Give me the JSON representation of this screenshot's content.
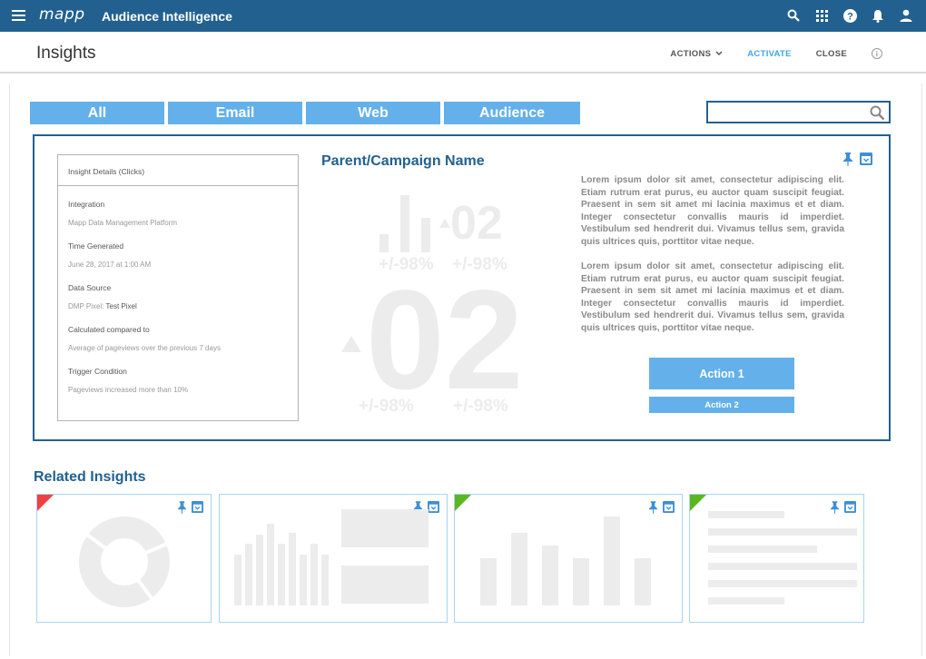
{
  "app": {
    "logo": "mapp",
    "title": "Audience Intelligence"
  },
  "topbar_icons": [
    "menu-icon",
    "search-icon",
    "apps-grid-icon",
    "help-icon",
    "notifications-bell-icon",
    "user-account-icon"
  ],
  "header": {
    "page_title": "Insights",
    "actions_label": "ACTIONS",
    "activate_label": "ACTIVATE",
    "close_label": "CLOSE",
    "info_glyph": "i"
  },
  "tabs": [
    "All",
    "Email",
    "Web",
    "Audience"
  ],
  "search": {
    "placeholder": ""
  },
  "insight": {
    "details_title": "Insight Details (Clicks)",
    "integration_label": "Integration",
    "integration_value": "Mapp Data Management Platform",
    "time_label": "Time Generated",
    "time_value": "June 28, 2017 at 1:00 AM",
    "source_label": "Data Source",
    "source_prefix": "DMP Pixel: ",
    "source_value": "Test Pixel",
    "calc_label": "Calculated compared to",
    "calc_value": "Average of pageviews over the previous 7 days",
    "trigger_label": "Trigger Condition",
    "trigger_value": "Pageviews increased more than 10%",
    "campaign_name": "Parent/Campaign Name",
    "bg_small_number": "02",
    "bg_small_pct_1": "+/-98%",
    "bg_small_pct_2": "+/-98%",
    "bg_big_number": "02",
    "bg_big_pct_1": "+/-98%",
    "bg_big_pct_2": "+/-98%",
    "lorem_1": "Lorem ipsum dolor sit amet, consectetur adipiscing elit. Etiam rutrum erat purus, eu auctor quam suscipit feugiat. Praesent in sem sit amet mi lacinia maximus et et diam. Integer consectetur convallis mauris id imperdiet. Vestibulum sed hendrerit dui. Vivamus tellus sem, gravida quis ultrices quis, porttitor vitae neque.",
    "lorem_2": "Lorem ipsum dolor sit amet, consectetur adipiscing elit. Etiam rutrum erat purus, eu auctor quam suscipit feugiat. Praesent in sem sit amet mi lacinia maximus et et diam. Integer consectetur convallis mauris id imperdiet. Vestibulum sed hendrerit dui. Vivamus tellus sem, gravida quis ultrices quis, porttitor vitae neque.",
    "action1_label": "Action 1",
    "action2_label": "Action 2"
  },
  "related": {
    "title": "Related Insights",
    "cards": [
      {
        "type": "donut",
        "corner_color": "#f04141"
      },
      {
        "type": "bars-and-blocks",
        "corner_color": ""
      },
      {
        "type": "bars",
        "corner_color": "#5ab81e"
      },
      {
        "type": "lines",
        "corner_color": "#5ab81e"
      }
    ]
  },
  "colors": {
    "topbar": "#22618f",
    "accent_blue": "#63b0ea",
    "activate": "#3ea6e6",
    "placeholder_gray": "#ececec"
  }
}
